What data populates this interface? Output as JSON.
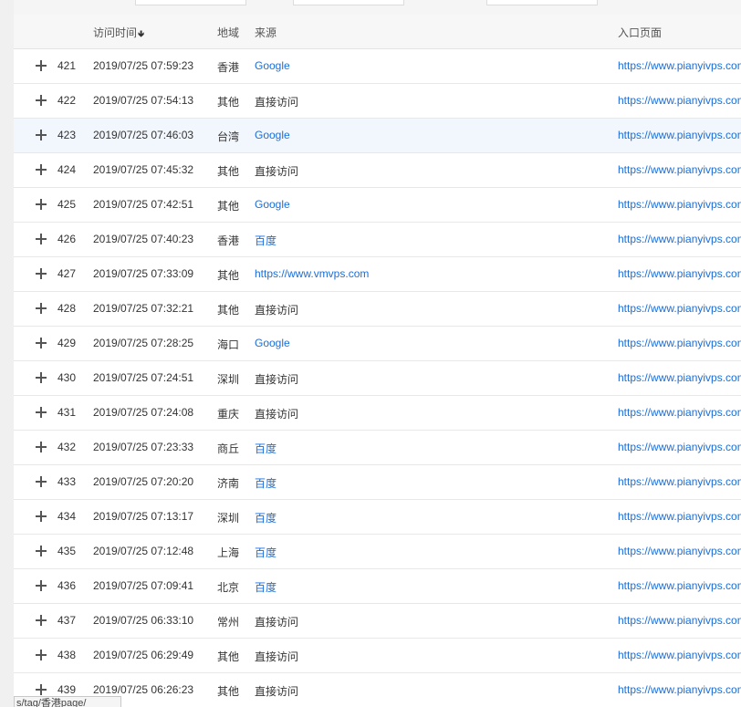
{
  "header": {
    "time": "访问时间",
    "region": "地域",
    "source": "来源",
    "entry": "入口页面"
  },
  "rows": [
    {
      "num": "421",
      "time": "2019/07/25 07:59:23",
      "region": "香港",
      "source": "Google",
      "link": true,
      "entry": "https://www.pianyivps.com"
    },
    {
      "num": "422",
      "time": "2019/07/25 07:54:13",
      "region": "其他",
      "source": "直接访问",
      "link": false,
      "entry": "https://www.pianyivps.com"
    },
    {
      "num": "423",
      "time": "2019/07/25 07:46:03",
      "region": "台湾",
      "source": "Google",
      "link": true,
      "entry": "https://www.pianyivps.com"
    },
    {
      "num": "424",
      "time": "2019/07/25 07:45:32",
      "region": "其他",
      "source": "直接访问",
      "link": false,
      "entry": "https://www.pianyivps.com"
    },
    {
      "num": "425",
      "time": "2019/07/25 07:42:51",
      "region": "其他",
      "source": "Google",
      "link": true,
      "entry": "https://www.pianyivps.com"
    },
    {
      "num": "426",
      "time": "2019/07/25 07:40:23",
      "region": "香港",
      "source": "百度",
      "link": true,
      "entry": "https://www.pianyivps.com"
    },
    {
      "num": "427",
      "time": "2019/07/25 07:33:09",
      "region": "其他",
      "source": "https://www.vmvps.com",
      "link": true,
      "entry": "https://www.pianyivps.com"
    },
    {
      "num": "428",
      "time": "2019/07/25 07:32:21",
      "region": "其他",
      "source": "直接访问",
      "link": false,
      "entry": "https://www.pianyivps.com"
    },
    {
      "num": "429",
      "time": "2019/07/25 07:28:25",
      "region": "海口",
      "source": "Google",
      "link": true,
      "entry": "https://www.pianyivps.com"
    },
    {
      "num": "430",
      "time": "2019/07/25 07:24:51",
      "region": "深圳",
      "source": "直接访问",
      "link": false,
      "entry": "https://www.pianyivps.com"
    },
    {
      "num": "431",
      "time": "2019/07/25 07:24:08",
      "region": "重庆",
      "source": "直接访问",
      "link": false,
      "entry": "https://www.pianyivps.com"
    },
    {
      "num": "432",
      "time": "2019/07/25 07:23:33",
      "region": "商丘",
      "source": "百度",
      "link": true,
      "entry": "https://www.pianyivps.com"
    },
    {
      "num": "433",
      "time": "2019/07/25 07:20:20",
      "region": "济南",
      "source": "百度",
      "link": true,
      "entry": "https://www.pianyivps.com"
    },
    {
      "num": "434",
      "time": "2019/07/25 07:13:17",
      "region": "深圳",
      "source": "百度",
      "link": true,
      "entry": "https://www.pianyivps.com"
    },
    {
      "num": "435",
      "time": "2019/07/25 07:12:48",
      "region": "上海",
      "source": "百度",
      "link": true,
      "entry": "https://www.pianyivps.com"
    },
    {
      "num": "436",
      "time": "2019/07/25 07:09:41",
      "region": "北京",
      "source": "百度",
      "link": true,
      "entry": "https://www.pianyivps.com"
    },
    {
      "num": "437",
      "time": "2019/07/25 06:33:10",
      "region": "常州",
      "source": "直接访问",
      "link": false,
      "entry": "https://www.pianyivps.com"
    },
    {
      "num": "438",
      "time": "2019/07/25 06:29:49",
      "region": "其他",
      "source": "直接访问",
      "link": false,
      "entry": "https://www.pianyivps.com"
    },
    {
      "num": "439",
      "time": "2019/07/25 06:26:23",
      "region": "其他",
      "source": "直接访问",
      "link": false,
      "entry": "https://www.pianyivps.com"
    }
  ],
  "status_bar": "s/tag/香港page/",
  "colors": {
    "link": "#1a6ed8",
    "hover_row": "#f2f7fd",
    "header_bg": "#f7f7f7"
  }
}
